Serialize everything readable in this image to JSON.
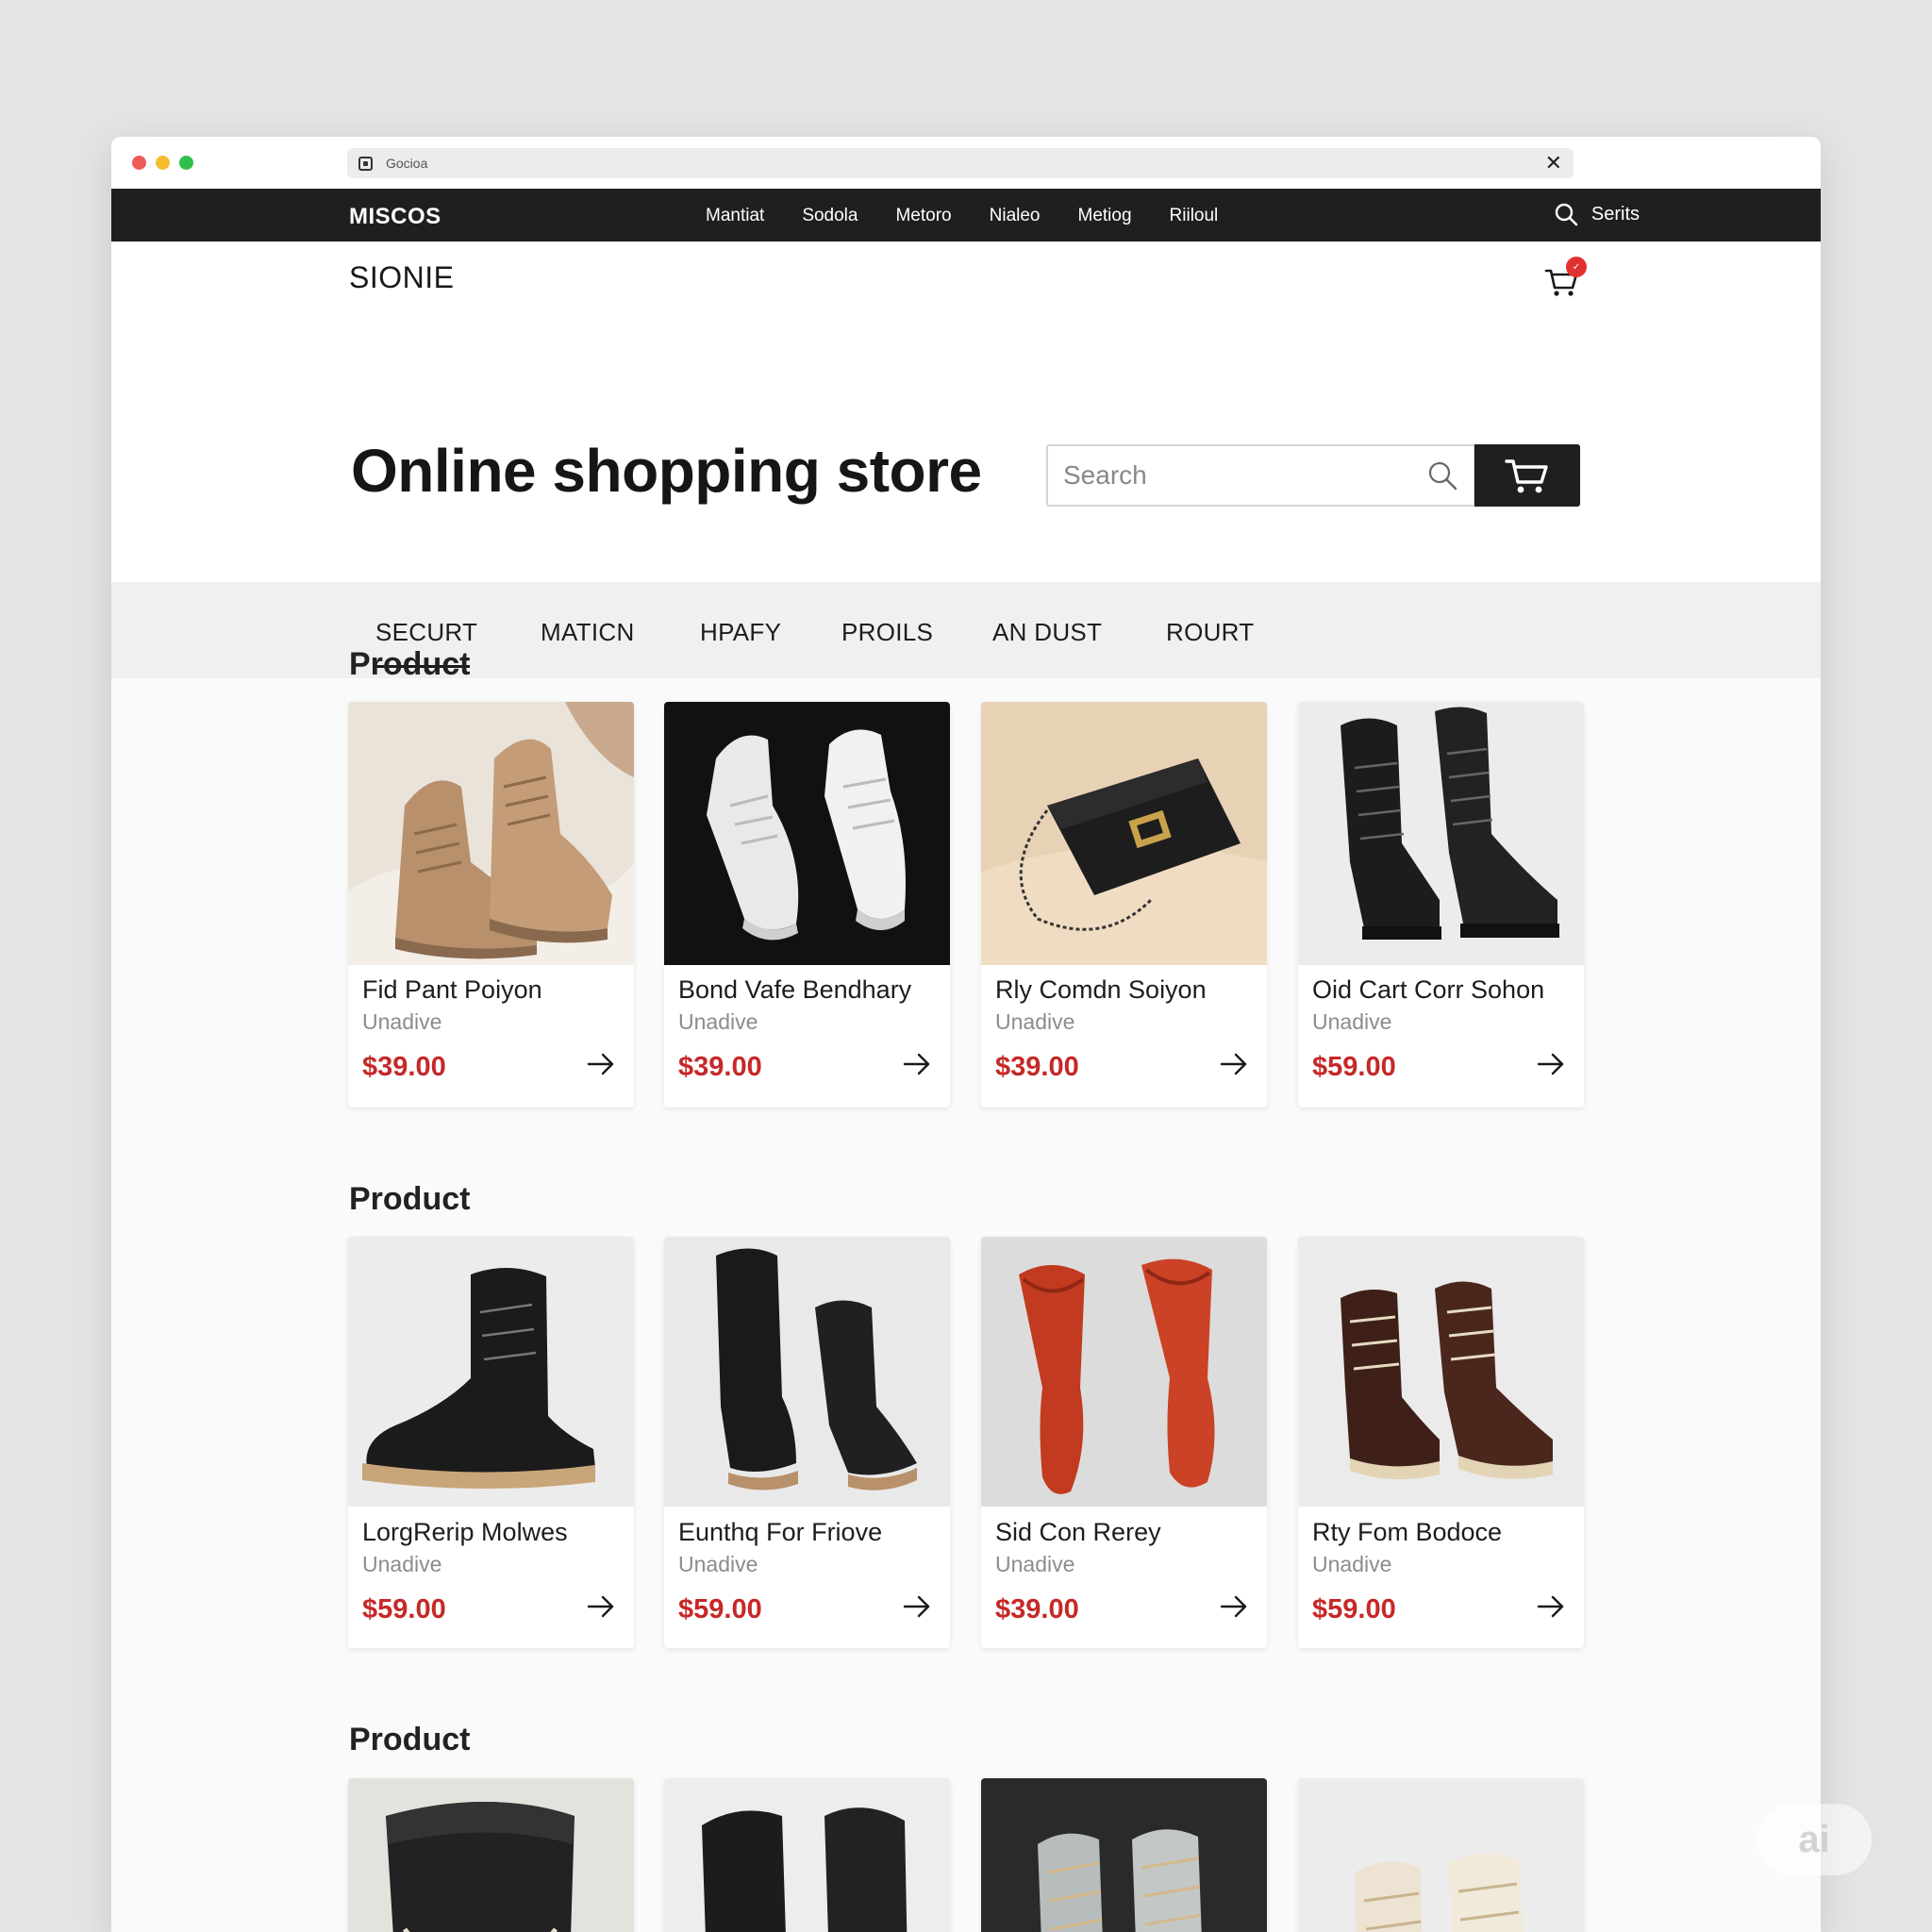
{
  "browser": {
    "url": "Gocioa"
  },
  "topnav": {
    "brand": "MISCOS",
    "links": [
      "Mantiat",
      "Sodola",
      "Metoro",
      "Nialeo",
      "Metiog",
      "Riiloul"
    ],
    "search_label": "Serits"
  },
  "store_name": "SIONIE",
  "cart_badge": "✓",
  "hero": {
    "title": "Online shopping store",
    "search_placeholder": "Search"
  },
  "categories": [
    {
      "label": "SECURT",
      "active": true
    },
    {
      "label": "MATICN",
      "active": false
    },
    {
      "label": "HPAFY",
      "active": false
    },
    {
      "label": "PROILS",
      "active": false
    },
    {
      "label": "AN DUST",
      "active": false
    },
    {
      "label": "ROURT",
      "active": false
    }
  ],
  "sections": [
    {
      "title": "Product",
      "products": [
        {
          "name": "Fid Pant Poiyon",
          "sub": "Unadive",
          "price": "$39.00",
          "image": "tan-boots"
        },
        {
          "name": "Bond Vafe Bendhary",
          "sub": "Unadive",
          "price": "$39.00",
          "image": "white-sneakers"
        },
        {
          "name": "Rly Comdn Soiyon",
          "sub": "Unadive",
          "price": "$39.00",
          "image": "black-handbag"
        },
        {
          "name": "Oid Cart Corr Sohon",
          "sub": "Unadive",
          "price": "$59.00",
          "image": "black-boots"
        }
      ]
    },
    {
      "title": "Product",
      "products": [
        {
          "name": "LorgRerip Molwes",
          "sub": "Unadive",
          "price": "$59.00",
          "image": "black-hiking-boot"
        },
        {
          "name": "Eunthq For Friove",
          "sub": "Unadive",
          "price": "$59.00",
          "image": "black-tall-boots"
        },
        {
          "name": "Sid Con Rerey",
          "sub": "Unadive",
          "price": "$39.00",
          "image": "red-socks"
        },
        {
          "name": "Rty Fom Bodoce",
          "sub": "Unadive",
          "price": "$59.00",
          "image": "brown-boots"
        }
      ]
    },
    {
      "title": "Product",
      "products": [
        {
          "image": "black-bag"
        },
        {
          "image": "black-boots-dark"
        },
        {
          "image": "grey-boots"
        },
        {
          "image": "cream-boots"
        }
      ]
    }
  ],
  "watermark": "ai",
  "colors": {
    "nav_bg": "#1f1f1f",
    "price": "#c62828",
    "badge": "#e0302f"
  }
}
